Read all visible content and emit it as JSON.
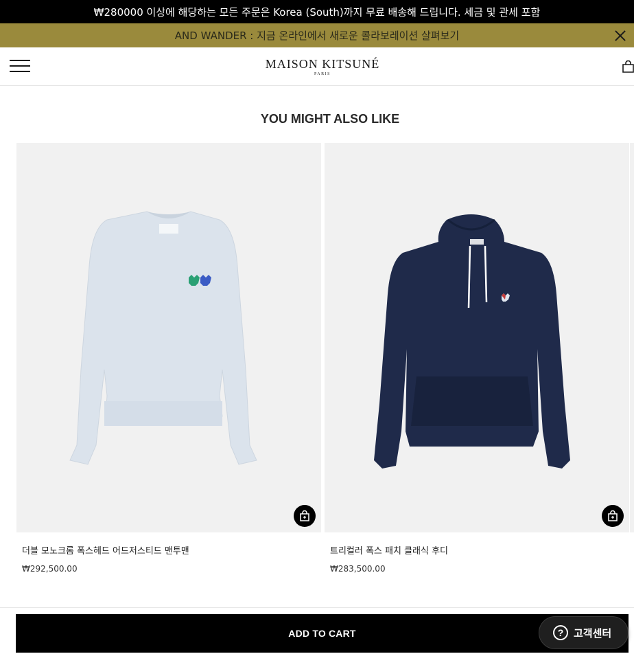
{
  "promo": {
    "text": "₩280000 이상에 해당하는 모든 주문은 Korea (South)까지 무료 배송해 드립니다. 세금 및 관세 포함"
  },
  "collab": {
    "text": "AND WANDER : 지금 온라인에서 새로운 콜라보레이션 살펴보기"
  },
  "header": {
    "logo": "MAISON KITSUNÉ",
    "logo_sub": "PARIS"
  },
  "section": {
    "title": "YOU MIGHT ALSO LIKE"
  },
  "products": [
    {
      "name": "더블 모노크롬 폭스헤드 어드저스티드 맨투맨",
      "price": "₩292,500.00"
    },
    {
      "name": "트리컬러 폭스 패치 클래식 후디",
      "price": "₩283,500.00"
    }
  ],
  "footer": {
    "add_to_cart": "ADD TO CART",
    "support": "고객센터"
  },
  "colors": {
    "collab_bg": "#9a8a3c",
    "sweatshirt": "#dbe3ec",
    "hoodie": "#1f2a4a"
  }
}
